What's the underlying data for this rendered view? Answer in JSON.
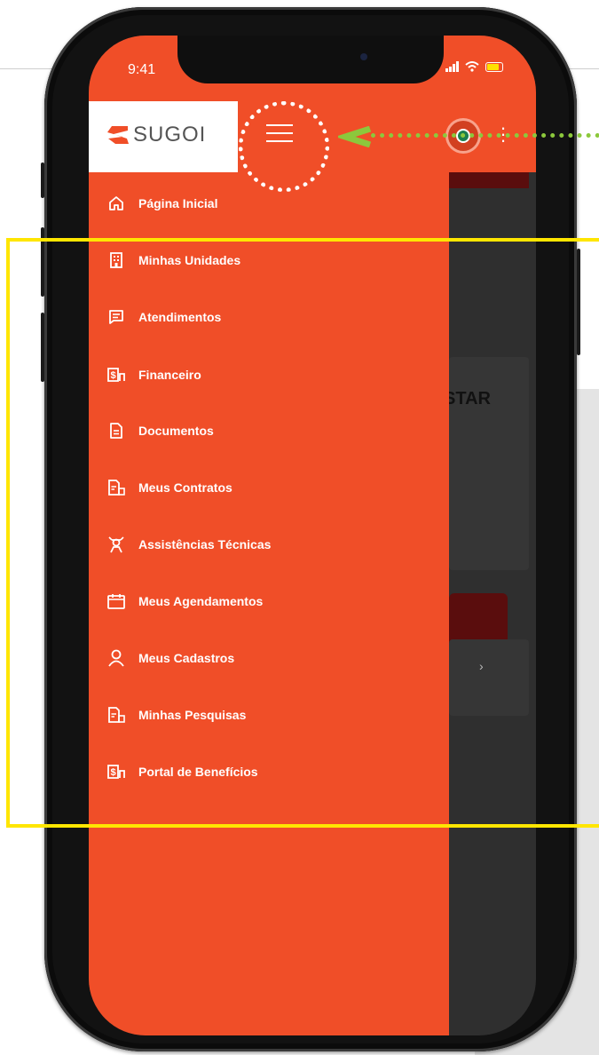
{
  "status_bar": {
    "time": "9:41"
  },
  "app": {
    "logo_text": "SUGOI",
    "brand_color": "#f04e28",
    "highlight_color": "#ffe600",
    "pointer_color": "#8cc83c"
  },
  "header": {
    "menu_icon": "hamburger-icon",
    "profile_icon": "avatar",
    "more_icon": "kebab-icon"
  },
  "menu": {
    "items": [
      {
        "label": "Página Inicial",
        "icon": "home-icon"
      },
      {
        "label": "Minhas Unidades",
        "icon": "building-icon"
      },
      {
        "label": "Atendimentos",
        "icon": "message-icon"
      },
      {
        "label": "Financeiro",
        "icon": "money-icon"
      },
      {
        "label": "Documentos",
        "icon": "document-icon"
      },
      {
        "label": "Meus Contratos",
        "icon": "contract-icon"
      },
      {
        "label": "Assistências Técnicas",
        "icon": "technician-icon"
      },
      {
        "label": "Meus Agendamentos",
        "icon": "calendar-icon"
      },
      {
        "label": "Meus Cadastros",
        "icon": "user-icon"
      },
      {
        "label": "Minhas Pesquisas",
        "icon": "survey-icon"
      },
      {
        "label": "Portal de Benefícios",
        "icon": "benefits-icon"
      }
    ]
  },
  "background_content": {
    "card_text": "STAR",
    "chevron": "›"
  }
}
